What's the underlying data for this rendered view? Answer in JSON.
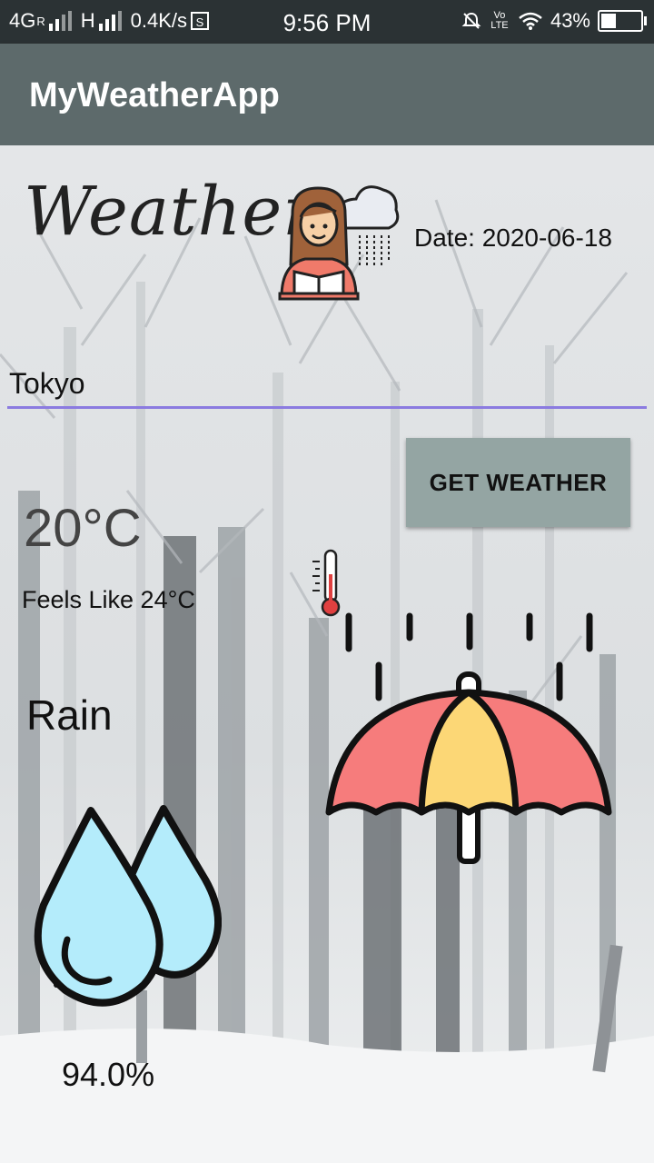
{
  "status_bar": {
    "network_left": "4G",
    "network_sup": "R",
    "network_h": "H",
    "speed": "0.4K/s",
    "s_badge": "S",
    "time": "9:56 PM",
    "volte": "Vo LTE",
    "battery": "43%",
    "battery_level": 0.43,
    "icons": [
      "signal-icon",
      "data-saver-icon",
      "mute-icon",
      "volte-icon",
      "wifi-icon",
      "battery-icon"
    ]
  },
  "app_bar": {
    "title": "MyWeatherApp",
    "color": "#5d6a6b"
  },
  "header": {
    "logo_text": "Weather",
    "date": "Date: 2020-06-18"
  },
  "search": {
    "city_value": "Tokyo",
    "underline_color": "#8b7be0"
  },
  "actions": {
    "get_weather_label": "GET WEATHER",
    "button_color": "#94a5a3"
  },
  "current": {
    "temperature": "20°C",
    "feels_like": "Feels Like 24°C",
    "condition": "Rain",
    "humidity": "94.0%"
  },
  "icons": {
    "girl": "girl-with-rain-cloud-icon",
    "thermometer": "thermometer-icon",
    "umbrella": "umbrella-rain-icon",
    "drops": "water-drops-icon"
  }
}
